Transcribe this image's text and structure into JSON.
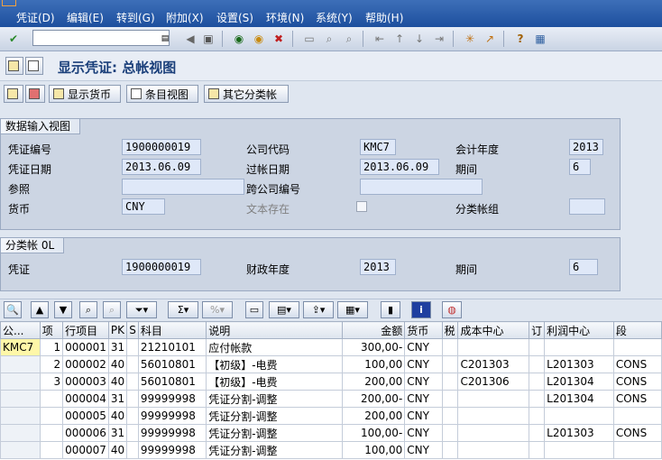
{
  "menu": {
    "items": [
      "凭证(D)",
      "编辑(E)",
      "转到(G)",
      "附加(X)",
      "设置(S)",
      "环境(N)",
      "系统(Y)",
      "帮助(H)"
    ]
  },
  "toolbar": {
    "command_value": "",
    "icons": [
      "check-icon",
      "dropdown-icon",
      "back-arrow-icon",
      "save-icon",
      "back-icon",
      "exit-icon",
      "cancel-icon",
      "print-icon",
      "find-icon",
      "find-next-icon",
      "first-page-icon",
      "previous-page-icon",
      "next-page-icon",
      "last-page-icon",
      "create-session-icon",
      "shortcut-icon",
      "help-icon",
      "layout-icon"
    ]
  },
  "title": "显示凭证: 总帐视图",
  "app_toolbar": {
    "display_currency": "显示货币",
    "entry_view": "条目视图",
    "other_ledger": "其它分类帐"
  },
  "data_entry": {
    "group_title": "数据输入视图",
    "doc_number_label": "凭证编号",
    "doc_number": "1900000019",
    "company_code_label": "公司代码",
    "company_code": "KMC7",
    "fiscal_year_label": "会计年度",
    "fiscal_year": "2013",
    "doc_date_label": "凭证日期",
    "doc_date": "2013.06.09",
    "posting_date_label": "过帐日期",
    "posting_date": "2013.06.09",
    "period_label": "期间",
    "period": "6",
    "reference_label": "参照",
    "reference": "",
    "cross_company_label": "跨公司编号",
    "cross_company": "",
    "currency_label": "货币",
    "currency": "CNY",
    "text_exists_label": "文本存在",
    "ledger_group_label": "分类帐组",
    "ledger_group": ""
  },
  "ledger": {
    "group_title": "分类帐 0L",
    "voucher_label": "凭证",
    "voucher": "1900000019",
    "fiscal_year_label": "财政年度",
    "fiscal_year": "2013",
    "period_label": "期间",
    "period": "6"
  },
  "grid": {
    "headers": [
      "公...",
      "项",
      "行项目",
      "PK",
      "S",
      "科目",
      "说明",
      "金额",
      "货币",
      "税",
      "成本中心",
      "订",
      "利润中心",
      "段"
    ],
    "rows": [
      [
        "KMC7",
        "1",
        "000001",
        "31",
        "",
        "21210101",
        "应付帐款",
        "300,00-",
        "CNY",
        "",
        "",
        "",
        "",
        ""
      ],
      [
        "",
        "2",
        "000002",
        "40",
        "",
        "56010801",
        "【初级】-电费",
        "100,00",
        "CNY",
        "",
        "C201303",
        "",
        "L201303",
        "CONS"
      ],
      [
        "",
        "3",
        "000003",
        "40",
        "",
        "56010801",
        "【初级】-电费",
        "200,00",
        "CNY",
        "",
        "C201306",
        "",
        "L201304",
        "CONS"
      ],
      [
        "",
        "",
        "000004",
        "31",
        "",
        "99999998",
        "凭证分割-调整",
        "200,00-",
        "CNY",
        "",
        "",
        "",
        "L201304",
        "CONS"
      ],
      [
        "",
        "",
        "000005",
        "40",
        "",
        "99999998",
        "凭证分割-调整",
        "200,00",
        "CNY",
        "",
        "",
        "",
        "",
        ""
      ],
      [
        "",
        "",
        "000006",
        "31",
        "",
        "99999998",
        "凭证分割-调整",
        "100,00-",
        "CNY",
        "",
        "",
        "",
        "L201303",
        "CONS"
      ],
      [
        "",
        "",
        "000007",
        "40",
        "",
        "99999998",
        "凭证分割-调整",
        "100,00",
        "CNY",
        "",
        "",
        "",
        "",
        ""
      ]
    ]
  }
}
